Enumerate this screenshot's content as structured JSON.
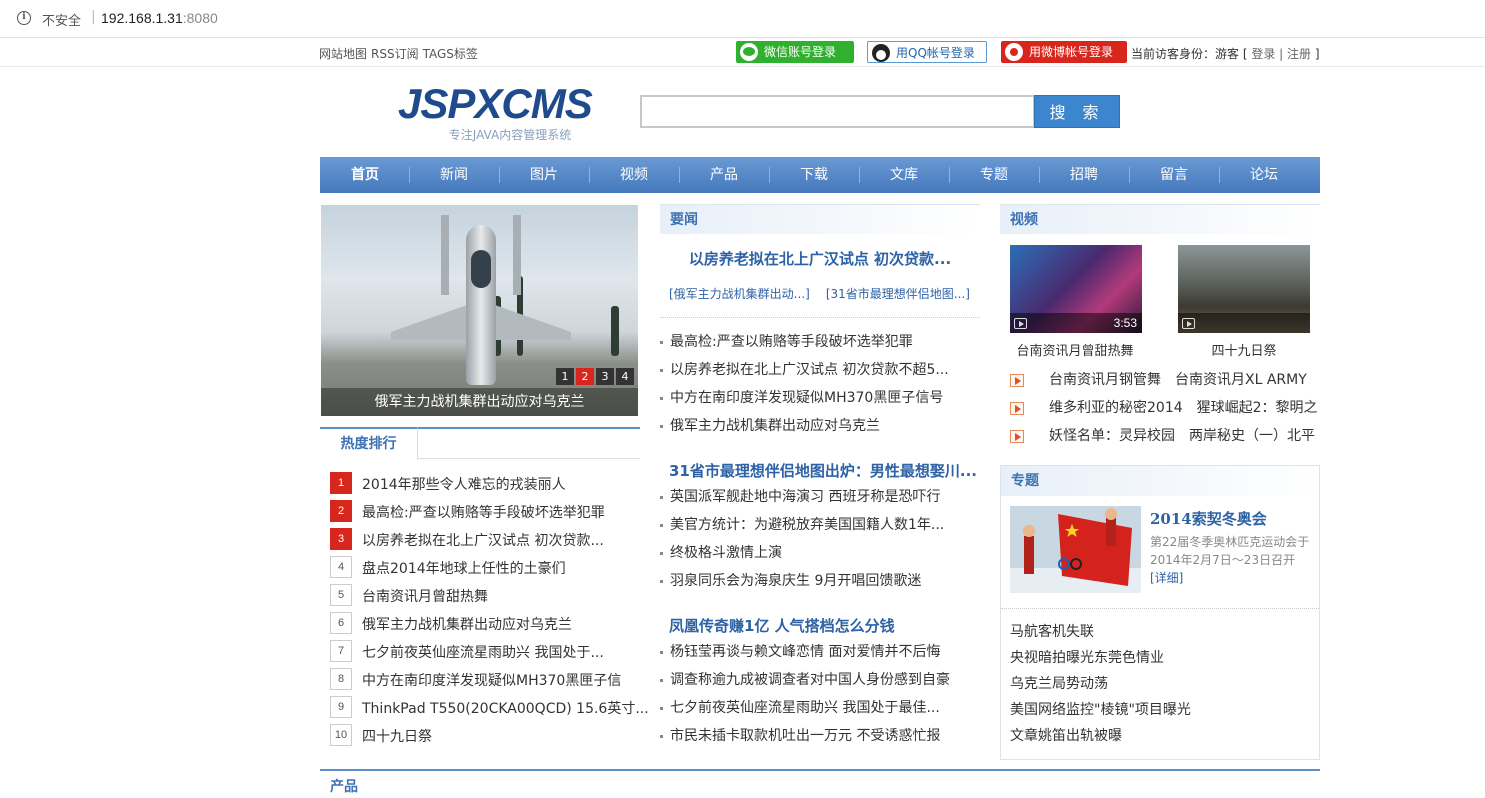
{
  "browser": {
    "security_label": "不安全",
    "host": "192.168.1.31",
    "port": ":8080"
  },
  "topbar": {
    "links": [
      "网站地图",
      "RSS订阅",
      "TAGS标签"
    ],
    "wechat_login": "微信账号登录",
    "qq_login": "用QQ帐号登录",
    "weibo_login": "用微博帐号登录",
    "visitor_label": "当前访客身份：游客 [",
    "login_link": "登录",
    "bar_sep": "|",
    "register_link": "注册",
    "bracket_close": "]"
  },
  "header": {
    "logo_text": "JSPXCMS",
    "logo_tagline": "专注JAVA内容管理系统",
    "search_button": "搜 索"
  },
  "nav": {
    "items": [
      "首页",
      "新闻",
      "图片",
      "视频",
      "产品",
      "下载",
      "文库",
      "专题",
      "招聘",
      "留言",
      "论坛"
    ]
  },
  "slideshow": {
    "caption": "俄军主力战机集群出动应对乌克兰",
    "pages": [
      "1",
      "2",
      "3",
      "4"
    ],
    "active_page": "2"
  },
  "hot": {
    "title": "热度排行",
    "items": [
      {
        "rank": "1",
        "text": "2014年那些令人难忘的戎装丽人"
      },
      {
        "rank": "2",
        "text": "最高检:严查以贿赂等手段破坏选举犯罪"
      },
      {
        "rank": "3",
        "text": "以房养老拟在北上广汉试点 初次贷款..."
      },
      {
        "rank": "4",
        "text": "盘点2014年地球上任性的土豪们"
      },
      {
        "rank": "5",
        "text": "台南资讯月曾甜热舞"
      },
      {
        "rank": "6",
        "text": "俄军主力战机集群出动应对乌克兰"
      },
      {
        "rank": "7",
        "text": "七夕前夜英仙座流星雨助兴 我国处于..."
      },
      {
        "rank": "8",
        "text": "中方在南印度洋发现疑似MH370黑匣子信"
      },
      {
        "rank": "9",
        "text": "ThinkPad T550(20CKA00QCD) 15.6英寸..."
      },
      {
        "rank": "10",
        "text": "四十九日祭"
      }
    ]
  },
  "important": {
    "title": "要闻",
    "headline": "以房养老拟在北上广汉试点 初次贷款...",
    "sublinks": [
      "[俄军主力战机集群出动...]",
      "[31省市最理想伴侣地图...]"
    ],
    "group1": [
      "最高检:严查以贿赂等手段破坏选举犯罪",
      "以房养老拟在北上广汉试点 初次贷款不超5...",
      "中方在南印度洋发现疑似MH370黑匣子信号",
      "俄军主力战机集群出动应对乌克兰"
    ],
    "bold2": "31省市最理想伴侣地图出炉：男性最想娶川...",
    "group2": [
      "英国派军舰赴地中海演习 西班牙称是恐吓行",
      "美官方统计：为避税放弃美国国籍人数1年...",
      "终极格斗激情上演",
      "羽泉同乐会为海泉庆生 9月开唱回馈歌迷"
    ],
    "bold3": "凤凰传奇赚1亿 人气搭档怎么分钱",
    "group3": [
      "杨钰莹再谈与赖文峰恋情 面对爱情并不后悔",
      "调查称逾九成被调查者对中国人身份感到自豪",
      "七夕前夜英仙座流星雨助兴 我国处于最佳...",
      "市民未插卡取款机吐出一万元 不受诱惑忙报"
    ]
  },
  "video": {
    "title": "视频",
    "thumbs": [
      {
        "caption": "台南资讯月曾甜热舞",
        "duration": "3:53"
      },
      {
        "caption": "四十九日祭",
        "duration": ""
      }
    ],
    "list": [
      [
        "台南资讯月钢管舞",
        "台南资讯月XL ARMY"
      ],
      [
        "维多利亚的秘密2014",
        "猩球崛起2：黎明之"
      ],
      [
        "妖怪名单：灵异校园",
        "两岸秘史（一）北平"
      ]
    ]
  },
  "topic": {
    "title": "专题",
    "feature_title": "2014索契冬奥会",
    "feature_desc": "第22届冬季奥林匹克运动会于2014年2月7日～23日召开",
    "feature_more": "[详细]",
    "list": [
      "马航客机失联",
      "央视暗拍曝光东莞色情业",
      "乌克兰局势动荡",
      "美国网络监控\"棱镜\"项目曝光",
      "文章姚笛出轨被曝"
    ]
  },
  "product": {
    "title": "产品"
  }
}
